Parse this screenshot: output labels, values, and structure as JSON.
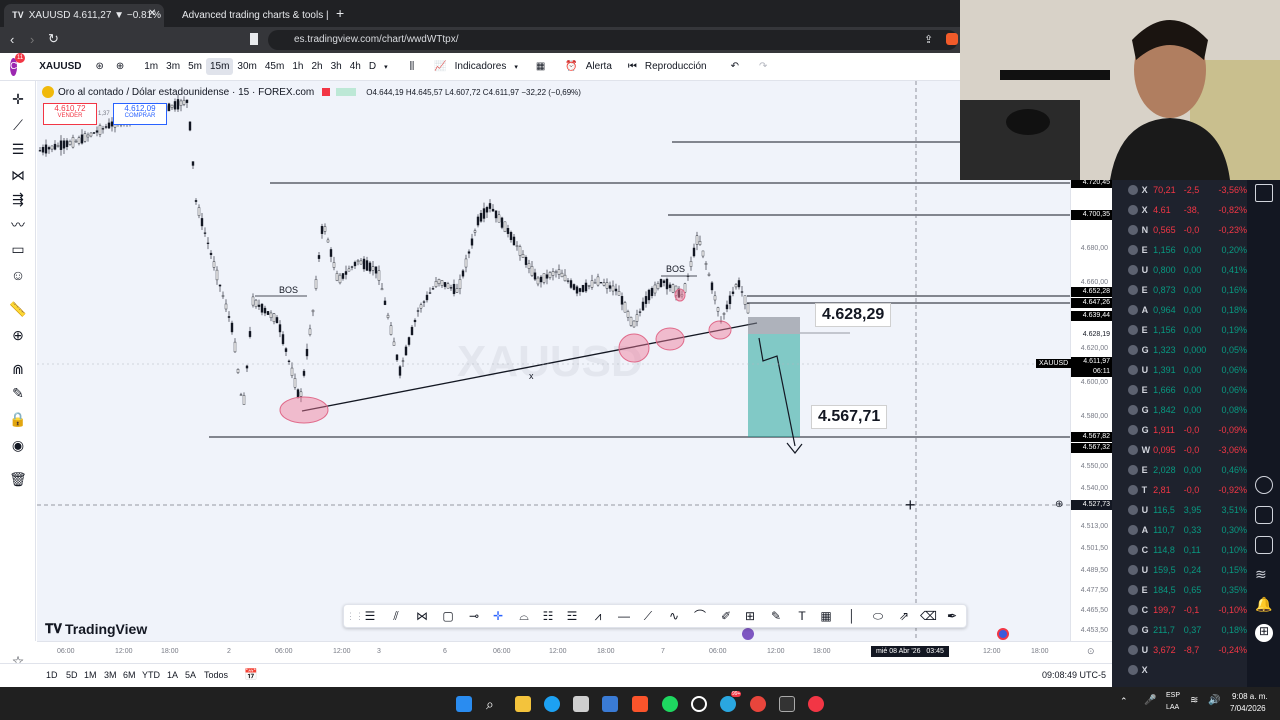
{
  "browser": {
    "tabs": [
      {
        "title": "XAUUSD 4.611,27 ▼ −0.81% do"
      },
      {
        "title": "Advanced trading charts & tools | Tra"
      }
    ],
    "url": "es.tradingview.com/chart/wwdWTtpx/"
  },
  "toolbar": {
    "symbol": "XAUUSD",
    "intervals": [
      "1m",
      "3m",
      "5m",
      "15m",
      "30m",
      "45m",
      "1h",
      "2h",
      "3h",
      "4h",
      "D"
    ],
    "selected_interval": "15m",
    "indicators_label": "Indicadores",
    "alert_label": "Alerta",
    "replay_label": "Reproducción",
    "avatar_badge": "11"
  },
  "chart": {
    "legend_title": "Oro al contado / Dólar estadounidense · 15 · FOREX.com",
    "ohlc": "O4.644,19 H4.645,57 L4.607,72 C4.611,97 −32,22 (−0,69%)",
    "sell_price": "4.610,72",
    "sell_label": "VENDER",
    "spread": "1,37",
    "buy_price": "4.612,09",
    "buy_label": "COMPRAR",
    "watermark": "XAUUSD",
    "bos_label_1": "BOS",
    "bos_label_2": "BOS",
    "x_mark": "x",
    "callout_1": "4.628,29",
    "callout_2": "4.567,71",
    "brand": "TradingView"
  },
  "price_axis": {
    "labels": [
      "4.680,00",
      "4.660,00",
      "4.620,00",
      "4.600,00",
      "4.580,00",
      "4.550,00",
      "4.540,00",
      "4.513,00",
      "4.501,50",
      "4.489,50",
      "4.477,50",
      "4.465,50",
      "4.453,50"
    ],
    "tags": [
      {
        "text": "4.720,45"
      },
      {
        "text": "4.700,35"
      },
      {
        "text": "4.652,28"
      },
      {
        "text": "4.647,26"
      },
      {
        "text": "4.639,44"
      },
      {
        "text": "4.628,19"
      },
      {
        "text": "4.611,97"
      },
      {
        "text": "06:11"
      },
      {
        "text": "4.567,82"
      },
      {
        "text": "4.567,32"
      },
      {
        "text": "4.527,73"
      }
    ],
    "symbol_tag": "XAUUSD"
  },
  "time_axis": {
    "labels": [
      "06:00",
      "12:00",
      "18:00",
      "2",
      "06:00",
      "12:00",
      "3",
      "6",
      "06:00",
      "12:00",
      "18:00",
      "7",
      "06:00",
      "12:00",
      "18:00",
      "12:00",
      "18:00"
    ],
    "crosshair_label": "mié 08 Abr '26   03:45"
  },
  "bottom": {
    "ranges": [
      "1D",
      "5D",
      "1M",
      "3M",
      "6M",
      "YTD",
      "1A",
      "5A",
      "Todos"
    ],
    "clock": "09:08:49 UTC-5"
  },
  "watchlist": [
    {
      "sym": "X",
      "last": "70,21",
      "chg": "-2,5",
      "pct": "-3,56%",
      "neg": true
    },
    {
      "sym": "X",
      "last": "4.61",
      "chg": "-38,",
      "pct": "-0,82%",
      "neg": true
    },
    {
      "sym": "N",
      "last": "0,565",
      "chg": "-0,0",
      "pct": "-0,23%",
      "neg": true
    },
    {
      "sym": "E",
      "last": "1,156",
      "chg": "0,00",
      "pct": "0,20%",
      "neg": false
    },
    {
      "sym": "U",
      "last": "0,800",
      "chg": "0,00",
      "pct": "0,41%",
      "neg": false
    },
    {
      "sym": "E",
      "last": "0,873",
      "chg": "0,00",
      "pct": "0,16%",
      "neg": false
    },
    {
      "sym": "A",
      "last": "0,964",
      "chg": "0,00",
      "pct": "0,18%",
      "neg": false
    },
    {
      "sym": "E",
      "last": "1,156",
      "chg": "0,00",
      "pct": "0,19%",
      "neg": false
    },
    {
      "sym": "G",
      "last": "1,323",
      "chg": "0,000",
      "pct": "0,05%",
      "neg": false
    },
    {
      "sym": "U",
      "last": "1,391",
      "chg": "0,00",
      "pct": "0,06%",
      "neg": false
    },
    {
      "sym": "E",
      "last": "1,666",
      "chg": "0,00",
      "pct": "0,06%",
      "neg": false
    },
    {
      "sym": "G",
      "last": "1,842",
      "chg": "0,00",
      "pct": "0,08%",
      "neg": false
    },
    {
      "sym": "G",
      "last": "1,911",
      "chg": "-0,0",
      "pct": "-0,09%",
      "neg": true
    },
    {
      "sym": "W",
      "last": "0,095",
      "chg": "-0,0",
      "pct": "-3,06%",
      "neg": true
    },
    {
      "sym": "E",
      "last": "2,028",
      "chg": "0,00",
      "pct": "0,46%",
      "neg": false
    },
    {
      "sym": "T",
      "last": "2,81",
      "chg": "-0,0",
      "pct": "-0,92%",
      "neg": true
    },
    {
      "sym": "U",
      "last": "116,5",
      "chg": "3,95",
      "pct": "3,51%",
      "neg": false
    },
    {
      "sym": "A",
      "last": "110,7",
      "chg": "0,33",
      "pct": "0,30%",
      "neg": false
    },
    {
      "sym": "C",
      "last": "114,8",
      "chg": "0,11",
      "pct": "0,10%",
      "neg": false
    },
    {
      "sym": "U",
      "last": "159,5",
      "chg": "0,24",
      "pct": "0,15%",
      "neg": false
    },
    {
      "sym": "E",
      "last": "184,5",
      "chg": "0,65",
      "pct": "0,35%",
      "neg": false
    },
    {
      "sym": "C",
      "last": "199,7",
      "chg": "-0,1",
      "pct": "-0,10%",
      "neg": true
    },
    {
      "sym": "G",
      "last": "211,7",
      "chg": "0,37",
      "pct": "0,18%",
      "neg": false
    },
    {
      "sym": "U",
      "last": "3,672",
      "chg": "-8,7",
      "pct": "-0,24%",
      "neg": true
    },
    {
      "sym": "X",
      "last": "",
      "chg": "",
      "pct": "",
      "neg": false
    }
  ],
  "taskbar": {
    "lang": "ESP",
    "lang2": "LAA",
    "time": "9:08 a. m.",
    "date": "7/04/2026",
    "badge": "99+"
  },
  "colors": {
    "accent": "#2962ff",
    "negative": "#f23645",
    "positive": "#089981",
    "zone": "#26a69a"
  }
}
